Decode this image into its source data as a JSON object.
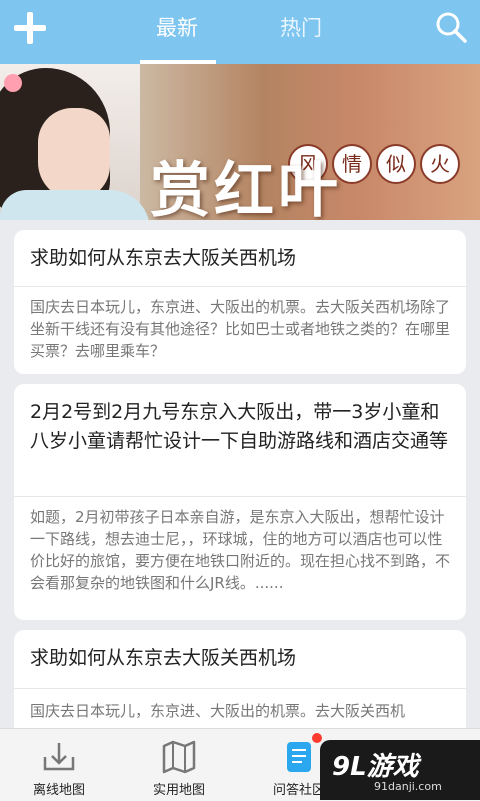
{
  "tabs": [
    {
      "label": "最新",
      "selected": true
    },
    {
      "label": "热门",
      "selected": false
    }
  ],
  "icons": {
    "add": "plus-icon",
    "search": "search-icon"
  },
  "banner": {
    "title": "赏红叶",
    "subtitle_chars": [
      "风",
      "情",
      "似",
      "火"
    ]
  },
  "posts": [
    {
      "title": "求助如何从东京去大阪关西机场",
      "body": "国庆去日本玩儿，东京进、大阪出的机票。去大阪关西机场除了坐新干线还有没有其他途径？比如巴士或者地铁之类的？在哪里买票？去哪里乘车？"
    },
    {
      "title": "2月2号到2月九号东京入大阪出，带一3岁小童和八岁小童请帮忙设计一下自助游路线和酒店交通等",
      "body": "如题，2月初带孩子日本亲自游，是东京入大阪出，想帮忙设计一下路线，想去迪士尼，，环球城，住的地方可以酒店也可以性价比好的旅馆，要方便在地铁口附近的。现在担心找不到路，不会看那复杂的地铁图和什么JR线。......"
    },
    {
      "title": "求助如何从东京去大阪关西机场",
      "body": "国庆去日本玩儿，东京进、大阪出的机票。去大阪关西机"
    }
  ],
  "nav": [
    {
      "label": "离线地图",
      "icon": "download-tray-icon"
    },
    {
      "label": "实用地图",
      "icon": "map-icon"
    },
    {
      "label": "问答社区",
      "icon": "qa-document-icon",
      "badge": true
    },
    {
      "label": "",
      "icon": "more-icon"
    }
  ],
  "watermark": {
    "logo": "9L游戏",
    "url": "91danji.com"
  },
  "colors": {
    "topbar": "#7ec5f0",
    "badge": "#ff3b30",
    "active_icon": "#2aa7ee"
  }
}
